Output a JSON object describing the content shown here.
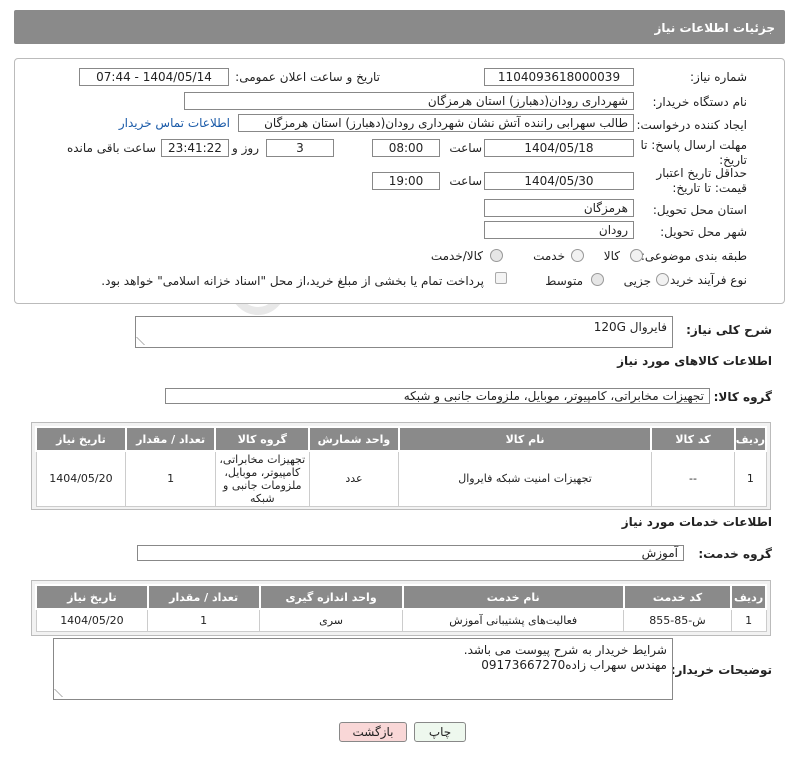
{
  "header": {
    "title": "جزئیات اطلاعات نیاز"
  },
  "form": {
    "need_number": {
      "label": "شماره نیاز:",
      "value": "1104093618000039"
    },
    "announce": {
      "label": "تاریخ و ساعت اعلان عمومی:",
      "value": "1404/05/14 - 07:44"
    },
    "buyer": {
      "label": "نام دستگاه خریدار:",
      "value": "شهرداری رودان(دهبارز) استان هرمزگان"
    },
    "requester": {
      "label": "ایجاد کننده درخواست:",
      "value": "طالب سهرابی راننده آتش نشان شهرداری رودان(دهبارز) استان هرمزگان",
      "contact_link": "اطلاعات تماس خریدار"
    },
    "reply_deadline": {
      "label": "مهلت ارسال پاسخ: تا تاریخ:",
      "date": "1404/05/18",
      "time_label": "ساعت",
      "time": "08:00",
      "days": "3",
      "days_label": "روز و",
      "remaining": "23:41:22",
      "remaining_label": "ساعت باقی مانده"
    },
    "price_validity": {
      "label": "حداقل تاریخ اعتبار قیمت: تا تاریخ:",
      "date": "1404/05/30",
      "time_label": "ساعت",
      "time": "19:00"
    },
    "province": {
      "label": "استان محل تحویل:",
      "value": "هرمزگان"
    },
    "city": {
      "label": "شهر محل تحویل:",
      "value": "رودان"
    },
    "category": {
      "label": "طبقه بندی موضوعی:",
      "options": [
        "کالا",
        "خدمت",
        "کالا/خدمت"
      ],
      "selected": "کالا/خدمت"
    },
    "process": {
      "label": "نوع فرآیند خرید :",
      "options": [
        "جزیی",
        "متوسط"
      ],
      "selected": "متوسط",
      "payment_note": "پرداخت تمام یا بخشی از مبلغ خرید،از محل \"اسناد خزانه اسلامی\" خواهد بود."
    }
  },
  "description": {
    "label": "شرح کلی نیاز:",
    "value": "فایروال 120G"
  },
  "goods": {
    "section_title": "اطلاعات کالاهای مورد نیاز",
    "group_label": "گروه کالا:",
    "group_value": "تجهیزات مخابراتی، کامپیوتر، موبایل، ملزومات جانبی و شبکه",
    "columns": [
      "ردیف",
      "کد کالا",
      "نام کالا",
      "واحد شمارش",
      "گروه کالا",
      "تعداد / مقدار",
      "تاریخ نیاز"
    ],
    "rows": [
      {
        "row": "1",
        "code": "--",
        "name": "تجهیزات امنیت شبکه فایروال",
        "unit": "عدد",
        "group": "تجهیزات مخابراتی، کامپیوتر، موبایل، ملزومات جانبی و شبکه",
        "qty": "1",
        "date": "1404/05/20"
      }
    ]
  },
  "services": {
    "section_title": "اطلاعات خدمات مورد نیاز",
    "group_label": "گروه خدمت:",
    "group_value": "آموزش",
    "columns": [
      "ردیف",
      "کد خدمت",
      "نام خدمت",
      "واحد اندازه گیری",
      "تعداد / مقدار",
      "تاریخ نیاز"
    ],
    "rows": [
      {
        "row": "1",
        "code": "ش-85-855",
        "name": "فعالیت‌های پشتیبانی آموزش",
        "unit": "سری",
        "qty": "1",
        "date": "1404/05/20"
      }
    ]
  },
  "buyer_notes": {
    "label": "توضیحات خریدار:",
    "line1": "شرایط خریدار به شرح پیوست می باشد.",
    "line2": "مهندس سهراب زاده09173667270"
  },
  "buttons": {
    "print": "چاپ",
    "back": "بازگشت"
  },
  "colors": {
    "header_bg": "#8a8a8a",
    "link": "#1a5aa8",
    "back_button": "#f9d7d7",
    "print_button": "#eef8ee"
  }
}
